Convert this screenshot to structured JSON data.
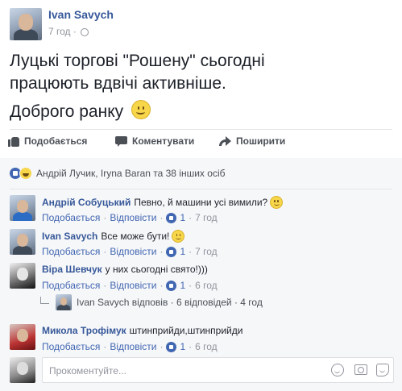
{
  "post": {
    "author": "Ivan Savych",
    "time": "7 год",
    "separator": "·",
    "text_line1": "Луцькі торгові \"Рошену\" сьогодні",
    "text_line2": "працюють вдвічі активніше.",
    "text_line3": "Доброго ранку"
  },
  "actions": {
    "like": "Подобається",
    "comment": "Коментувати",
    "share": "Поширити"
  },
  "reactions": {
    "summary": "Андрій Лучик, Iryna Baran та 38 інших осіб"
  },
  "comments": [
    {
      "author": "Андрій Собуцький",
      "text": "Певно, й машини усі вимили?",
      "like": "Подобається",
      "reply": "Відповісти",
      "likes": "1",
      "time": "7 год",
      "has_smile": true
    },
    {
      "author": "Ivan Savych",
      "text": "Все може бути!",
      "like": "Подобається",
      "reply": "Відповісти",
      "likes": "1",
      "time": "7 год",
      "has_smile": true
    },
    {
      "author": "Віра Шевчук",
      "text": "у них сьогодні свято!)))",
      "like": "Подобається",
      "reply": "Відповісти",
      "likes": "1",
      "time": "6 год",
      "has_smile": false
    },
    {
      "author": "Микола Трофімук",
      "text": "штинприйди,штинприйди",
      "like": "Подобається",
      "reply": "Відповісти",
      "likes": "1",
      "time": "6 год",
      "has_smile": false
    }
  ],
  "replies": {
    "text": "Ivan Savych відповів · 6 відповідей · 4 год"
  },
  "compose": {
    "placeholder": "Прокоментуйте..."
  },
  "colors": {
    "link": "#365899",
    "action_blue": "#4267b2",
    "muted": "#90949c",
    "panel_bg": "#f6f7f9"
  },
  "icons": [
    "globe-icon",
    "like-icon",
    "comment-icon",
    "share-icon",
    "like-reaction-icon",
    "haha-reaction-icon",
    "smile-emoji",
    "emoji-icon",
    "camera-icon",
    "sticker-icon"
  ]
}
